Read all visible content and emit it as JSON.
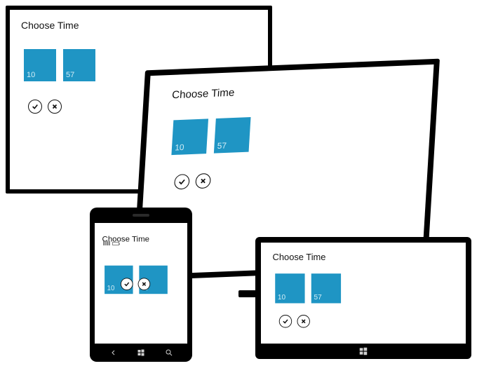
{
  "title": "Choose Time",
  "hour": "10",
  "minute": "57",
  "confirm_label": "confirm",
  "cancel_label": "cancel",
  "accent_color": "#1f95c4"
}
